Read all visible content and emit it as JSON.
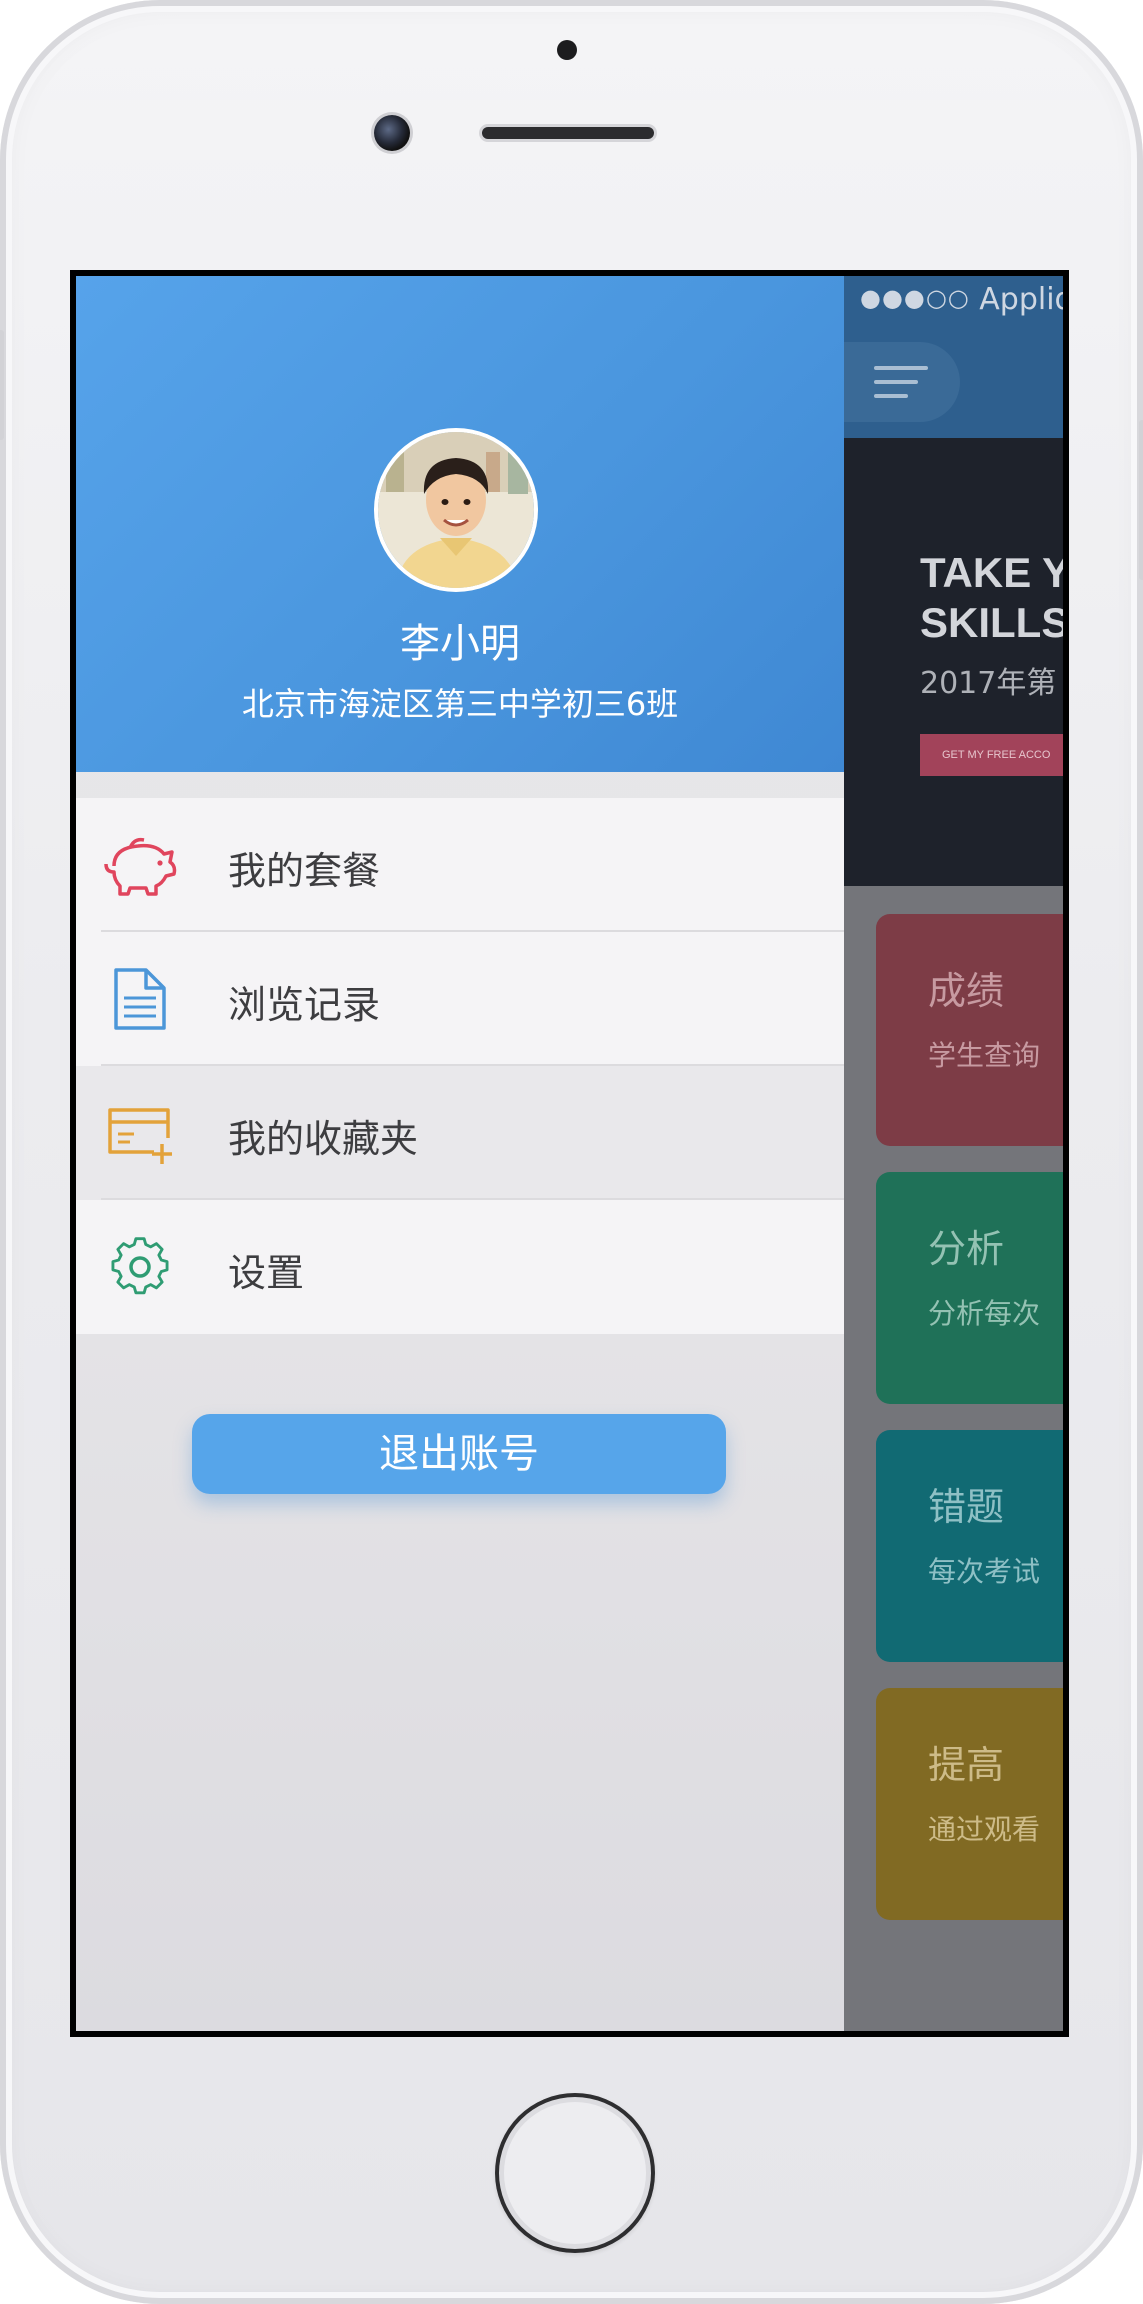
{
  "device": {
    "home_button_label": "home button"
  },
  "status_bar": {
    "signal_dots": "●●●○○",
    "carrier": "Applid"
  },
  "main_screen": {
    "hero": {
      "title": "TAKE Y\nSKILLS",
      "subtitle": "2017年第",
      "cta": "GET MY FREE ACCO"
    },
    "cards": [
      {
        "title": "成绩",
        "subtitle": "学生查询",
        "color": "#7d3c46",
        "text_color": "#c79aa1"
      },
      {
        "title": "分析",
        "subtitle": "分析每次",
        "color": "#1f7158",
        "text_color": "#94c2b3"
      },
      {
        "title": "错题",
        "subtitle": "每次考试",
        "color": "#116a73",
        "text_color": "#8ec0c5"
      },
      {
        "title": "提高",
        "subtitle": "通过观看",
        "color": "#816a23",
        "text_color": "#cdbb88"
      }
    ]
  },
  "drawer": {
    "profile": {
      "name": "李小明",
      "class": "北京市海淀区第三中学初三6班"
    },
    "menu_items": [
      {
        "label": "我的套餐",
        "icon": "piggy-bank-icon",
        "color": "#e0455d"
      },
      {
        "label": "浏览记录",
        "icon": "document-icon",
        "color": "#4c96d8"
      },
      {
        "label": "我的收藏夹",
        "icon": "card-add-icon",
        "color": "#e3a23a"
      },
      {
        "label": "设置",
        "icon": "gear-icon",
        "color": "#2f9c73"
      }
    ],
    "logout_label": "退出账号"
  },
  "colors": {
    "accent_blue": "#56a5ea",
    "profile_gradient_start": "#56a3ea",
    "profile_gradient_end": "#3f88d3"
  }
}
